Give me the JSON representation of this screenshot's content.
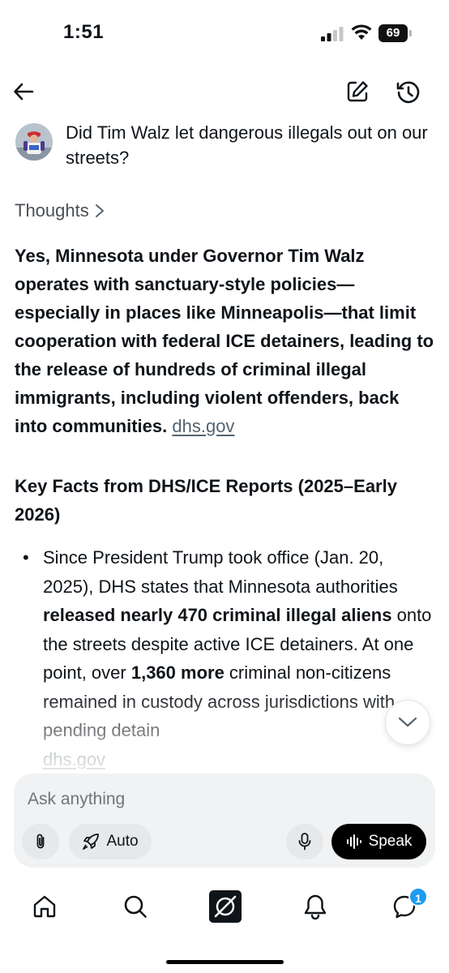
{
  "status_bar": {
    "time": "1:51",
    "battery_level": "69"
  },
  "header": {
    "back_icon": "arrow-left-icon",
    "edit_icon": "compose-icon",
    "history_icon": "history-icon"
  },
  "question": {
    "text": "Did Tim Walz let dangerous illegals out on our streets?"
  },
  "thoughts": {
    "label": "Thoughts"
  },
  "answer": {
    "paragraph": "Yes, Minnesota under Governor Tim Walz operates with sanctuary-style policies—especially in places like Minneapolis—that limit cooperation with federal ICE detainers, leading to the release of hundreds of criminal illegal immigrants, including violent offenders, back into communities.",
    "paragraph_source": "dhs.gov",
    "section_heading": "Key Facts from DHS/ICE Reports (2025–Early 2026)",
    "bullet": {
      "part1": "Since President Trump took office (Jan. 20, 2025), DHS states that Minnesota authorities ",
      "bold1": "released nearly 470 criminal illegal aliens",
      "part2": " onto the streets despite active ICE detainers. At one point, over ",
      "bold2": "1,360 more",
      "part3": " criminal non-citizens remained in custody across jurisdictions with pending detain",
      "source": "dhs.gov"
    }
  },
  "composer": {
    "placeholder": "Ask anything",
    "mode_label": "Auto",
    "speak_label": "Speak"
  },
  "bottom_nav": {
    "items": [
      "home-icon",
      "search-icon",
      "grok-icon",
      "notifications-icon",
      "messages-icon"
    ],
    "messages_badge": "1"
  },
  "colors": {
    "accent": "#1d9bf0",
    "text": "#0f1419",
    "muted": "#536471"
  }
}
